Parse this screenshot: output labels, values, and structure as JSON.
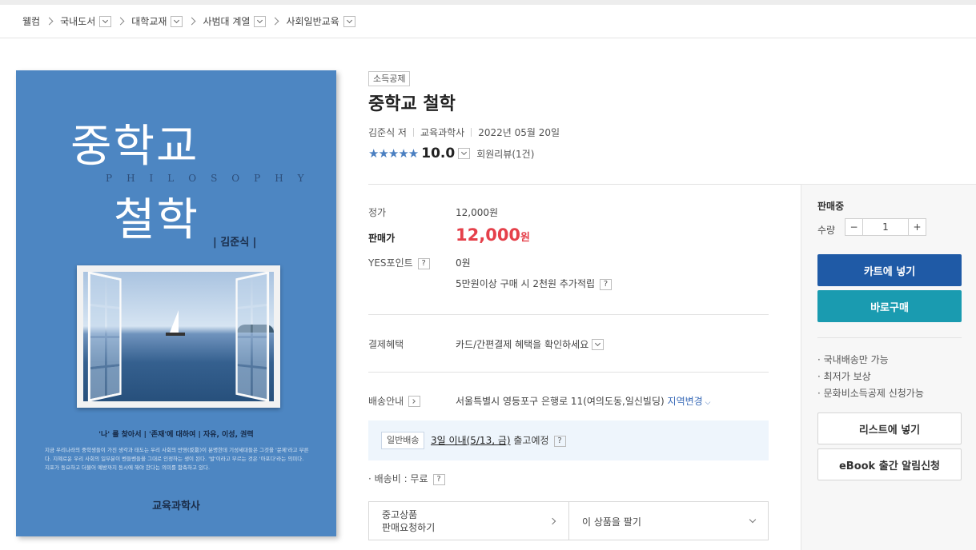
{
  "breadcrumb": {
    "home": "웰컴",
    "items": [
      "국내도서",
      "대학교재",
      "사범대 계열",
      "사회일반교육"
    ]
  },
  "cover": {
    "title_line1": "중학교",
    "title_line2": "철학",
    "subtitle_en": "PHILOSOPHY",
    "author": "| 김준식 |",
    "tagline": "'나' 를 찾아서 | '존재'에 대하여 | 자유, 이성, 권력",
    "body": "지금 우리나라의 중학생들이 가진 생각과 태도는 우리 사회의 반영(反影)이 분명한데 기성세대들은 그것을 '문제'라고 부른다. 지혜로운 우리 사회의 일부분이 벤들벤들을 그대로 인정하는 생이 된다. '발'이라고 부르는 것은 '아포다'라는 의미다. 지포가 동요하고 더불어 예방까지 동시에 해야 한다는 의미를 함축하고 있다.",
    "publisher": "교육과학사"
  },
  "product": {
    "badge": "소득공제",
    "title": "중학교 철학",
    "author": "김준식 저",
    "publisher": "교육과학사",
    "date": "2022년 05월 20일",
    "stars": "★★★★★",
    "score": "10.0",
    "review_label": "회원리뷰(1건)"
  },
  "price": {
    "list_label": "정가",
    "list_value": "12,000원",
    "sale_label": "판매가",
    "sale_amount": "12,000",
    "sale_unit": "원",
    "points_label": "YES포인트",
    "points_value": "0원",
    "points_extra": "5만원이상 구매 시 2천원 추가적립",
    "help_glyph": "?"
  },
  "payment": {
    "label": "결제혜택",
    "value": "카드/간편결제 혜택을 확인하세요"
  },
  "shipping": {
    "label": "배송안내",
    "address": "서울특별시 영등포구 은행로 11(여의도동,일신빌딩)",
    "change_link": "지역변경",
    "badge": "일반배송",
    "eta": "3일 이내(5/13, 금)",
    "eta_suffix": "출고예정",
    "fee": "· 배송비 : 무료"
  },
  "used": {
    "left_line1": "중고상품",
    "left_line2": "판매요청하기",
    "right": "이 상품을 팔기"
  },
  "panel": {
    "status": "판매중",
    "qty_label": "수량",
    "qty_minus": "−",
    "qty_value": "1",
    "qty_plus": "+",
    "cart_button": "카트에 넣기",
    "buy_button": "바로구매",
    "notes": [
      "· 국내배송만 가능",
      "· 최저가 보상",
      "· 문화비소득공제 신청가능"
    ],
    "list_button": "리스트에 넣기",
    "ebook_button": "eBook 출간 알림신청",
    "colors": {
      "cart": "#1f5aa6",
      "buy": "#1a9bb0"
    }
  }
}
